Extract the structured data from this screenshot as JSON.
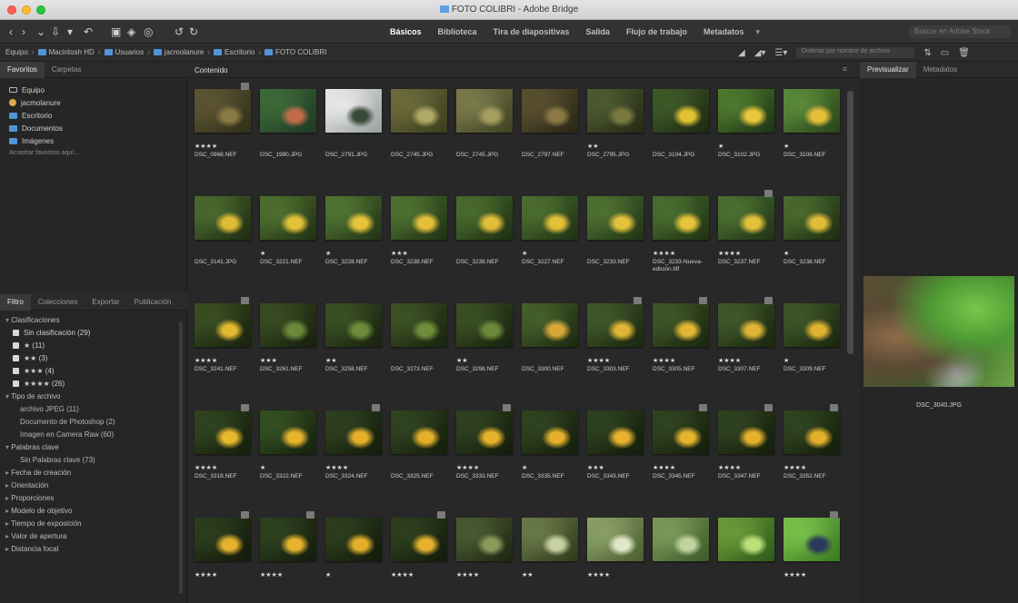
{
  "window": {
    "title": "FOTO COLIBRI - Adobe Bridge"
  },
  "workspaces": {
    "tabs": [
      "Básicos",
      "Biblioteca",
      "Tira de diapositivas",
      "Salida",
      "Flujo de trabajo",
      "Metadatos"
    ],
    "active": 0,
    "more": "▾"
  },
  "search": {
    "placeholder": "Buscar en Adobe Stock"
  },
  "path": {
    "crumbs": [
      "Equipo",
      "Macintosh HD",
      "Usuarios",
      "jacmolanure",
      "Escritorio",
      "FOTO COLIBRI"
    ]
  },
  "filter_search": {
    "placeholder": "Ordenar por nombre de archivo"
  },
  "left_top": {
    "tabs": [
      "Favoritos",
      "Carpetas"
    ],
    "items": [
      {
        "label": "Equipo",
        "icon": "computer-icon"
      },
      {
        "label": "jacmolanure",
        "icon": "user-icon"
      },
      {
        "label": "Escritorio",
        "icon": "folder-icon"
      },
      {
        "label": "Documentos",
        "icon": "folder-icon"
      },
      {
        "label": "Imágenes",
        "icon": "folder-icon"
      }
    ],
    "drag_hint": "Arrastrar favoritos aquí..."
  },
  "left_bottom": {
    "tabs": [
      "Filtro",
      "Colecciones",
      "Exportar",
      "Publicación"
    ],
    "rows": [
      {
        "type": "sec",
        "label": "Clasificaciones"
      },
      {
        "type": "item",
        "label": "Sin clasificación (29)",
        "check": true
      },
      {
        "type": "item",
        "label": "★ (11)",
        "check": true
      },
      {
        "type": "item",
        "label": "★★ (3)",
        "check": true
      },
      {
        "type": "item",
        "label": "★★★ (4)",
        "check": true
      },
      {
        "type": "item",
        "label": "★★★★ (26)",
        "check": true
      },
      {
        "type": "sec",
        "label": "Tipo de archivo"
      },
      {
        "type": "sub",
        "label": "archivo JPEG (11)"
      },
      {
        "type": "sub",
        "label": "Documento de Photoshop (2)"
      },
      {
        "type": "sub",
        "label": "Imagen en Camera Raw (60)"
      },
      {
        "type": "sec",
        "label": "Palabras clave"
      },
      {
        "type": "sub",
        "label": "Sin Palabras clave (73)"
      },
      {
        "type": "sec closed",
        "label": "Fecha de creación"
      },
      {
        "type": "sec closed",
        "label": "Orientación"
      },
      {
        "type": "sec closed",
        "label": "Proporciones"
      },
      {
        "type": "sec closed",
        "label": "Modelo de objetivo"
      },
      {
        "type": "sec closed",
        "label": "Tiempo de exposición"
      },
      {
        "type": "sec closed",
        "label": "Valor de apertura"
      },
      {
        "type": "sec closed",
        "label": "Distancia focal"
      }
    ]
  },
  "content": {
    "title": "Contenido",
    "menu": "≡"
  },
  "thumbnails": [
    {
      "stars": "★★★★",
      "name": "DSC_0968.NEF",
      "badge": true,
      "c1": "#5c5433",
      "c2": "#2f3018",
      "c3": "#8a7a44"
    },
    {
      "stars": "",
      "name": "DSC_1980.JPG",
      "badge": false,
      "c1": "#3d6a38",
      "c2": "#1f3a25",
      "c3": "#c26b4a"
    },
    {
      "stars": "",
      "name": "DSC_2791.JPG",
      "badge": false,
      "c1": "#e8e8e8",
      "c2": "#9aa0a0",
      "c3": "#3a4a3a"
    },
    {
      "stars": "",
      "name": "DSC_2745.JPG",
      "badge": false,
      "c1": "#6b6a3a",
      "c2": "#3c3e1f",
      "c3": "#b0a866"
    },
    {
      "stars": "",
      "name": "DSC_2745.JPG",
      "badge": false,
      "c1": "#7a7a4c",
      "c2": "#3f4221",
      "c3": "#a79d5f"
    },
    {
      "stars": "",
      "name": "DSC_2797.NEF",
      "badge": false,
      "c1": "#5a5030",
      "c2": "#2a2616",
      "c3": "#8c7a45"
    },
    {
      "stars": "★★",
      "name": "DSC_2795.JPG",
      "badge": false,
      "c1": "#4e5a30",
      "c2": "#252a16",
      "c3": "#7a7a40"
    },
    {
      "stars": "",
      "name": "DSC_3104.JPG",
      "badge": false,
      "c1": "#3e5a28",
      "c2": "#1e2a12",
      "c3": "#e2c234"
    },
    {
      "stars": "★",
      "name": "DSC_3102.JPG",
      "badge": false,
      "c1": "#4f7a30",
      "c2": "#1e3414",
      "c3": "#e8c73a"
    },
    {
      "stars": "★",
      "name": "DSC_3108.NEF",
      "badge": false,
      "c1": "#5a8a3a",
      "c2": "#2a4418",
      "c3": "#e6c03a"
    },
    {
      "stars": "",
      "name": "DSC_3141.JPG",
      "badge": false,
      "c1": "#4a6a2e",
      "c2": "#1f2c12",
      "c3": "#e0bc36"
    },
    {
      "stars": "★",
      "name": "DSC_3221.NEF",
      "badge": false,
      "c1": "#4f7030",
      "c2": "#223214",
      "c3": "#e3c23a"
    },
    {
      "stars": "★",
      "name": "DSC_3228.NEF",
      "badge": false,
      "c1": "#507432",
      "c2": "#223416",
      "c3": "#e5c43b"
    },
    {
      "stars": "★★★",
      "name": "DSC_3238.NEF",
      "badge": false,
      "c1": "#4e7230",
      "c2": "#203214",
      "c3": "#e4c03a"
    },
    {
      "stars": "",
      "name": "DSC_3238.NEF",
      "badge": false,
      "c1": "#4a6c2e",
      "c2": "#1e3012",
      "c3": "#e2be38"
    },
    {
      "stars": "★",
      "name": "DSC_3227.NEF",
      "badge": false,
      "c1": "#4c6e30",
      "c2": "#203214",
      "c3": "#e3c03a"
    },
    {
      "stars": "",
      "name": "DSC_3233.NEF",
      "badge": false,
      "c1": "#4e7232",
      "c2": "#223416",
      "c3": "#e4c23c"
    },
    {
      "stars": "★★★★",
      "name": "DSC_3233-Nueva-edición.tiff",
      "badge": false,
      "wrap": true,
      "c1": "#4a6e30",
      "c2": "#1f3214",
      "c3": "#e6c43c"
    },
    {
      "stars": "★★★★",
      "name": "DSC_3237.NEF",
      "badge": true,
      "c1": "#4c7032",
      "c2": "#203416",
      "c3": "#e3c13a"
    },
    {
      "stars": "★",
      "name": "DSC_3238.NEF",
      "badge": false,
      "c1": "#4a6a2e",
      "c2": "#1e2e12",
      "c3": "#e0bc38"
    },
    {
      "stars": "★★★★",
      "name": "DSC_3241.NEF",
      "badge": true,
      "c1": "#3a4e22",
      "c2": "#18220e",
      "c3": "#e0b832"
    },
    {
      "stars": "★★★",
      "name": "DSC_3261.NEF",
      "badge": false,
      "c1": "#384c22",
      "c2": "#17200e",
      "c3": "#6a8a3a"
    },
    {
      "stars": "★★",
      "name": "DSC_3258.NEF",
      "badge": false,
      "c1": "#3a5024",
      "c2": "#18220e",
      "c3": "#6c8c3c"
    },
    {
      "stars": "",
      "name": "DSC_3273.NEF",
      "badge": false,
      "c1": "#3c5224",
      "c2": "#19230f",
      "c3": "#6e8e3e"
    },
    {
      "stars": "★★",
      "name": "DSC_3298.NEF",
      "badge": false,
      "c1": "#3a5024",
      "c2": "#18220e",
      "c3": "#6a8a3a"
    },
    {
      "stars": "",
      "name": "DSC_3300.NEF",
      "badge": false,
      "c1": "#44602a",
      "c2": "#1c2a10",
      "c3": "#d8a83a"
    },
    {
      "stars": "★★★★",
      "name": "DSC_3303.NEF",
      "badge": true,
      "c1": "#40582a",
      "c2": "#1a2610",
      "c3": "#e0b434"
    },
    {
      "stars": "★★★★",
      "name": "DSC_3305.NEF",
      "badge": true,
      "c1": "#3e5628",
      "c2": "#1a2610",
      "c3": "#e2b634"
    },
    {
      "stars": "★★★★",
      "name": "DSC_3307.NEF",
      "badge": true,
      "c1": "#40582a",
      "c2": "#1a2610",
      "c3": "#e0b434"
    },
    {
      "stars": "★",
      "name": "DSC_3309.NEF",
      "badge": false,
      "c1": "#3e5628",
      "c2": "#1a260f",
      "c3": "#deb234"
    },
    {
      "stars": "★★★★",
      "name": "DSC_3318.NEF",
      "badge": true,
      "c1": "#304420",
      "c2": "#141e0c",
      "c3": "#e8b82e"
    },
    {
      "stars": "★",
      "name": "DSC_3322.NEF",
      "badge": false,
      "c1": "#345022",
      "c2": "#16220d",
      "c3": "#e6b42e"
    },
    {
      "stars": "★★★★",
      "name": "DSC_3324.NEF",
      "badge": true,
      "c1": "#2e4020",
      "c2": "#131c0b",
      "c3": "#e6b02c"
    },
    {
      "stars": "",
      "name": "DSC_3325.NEF",
      "badge": false,
      "c1": "#304420",
      "c2": "#141e0c",
      "c3": "#e4b02c"
    },
    {
      "stars": "★★★★",
      "name": "DSC_3333.NEF",
      "badge": true,
      "c1": "#2f4220",
      "c2": "#141d0b",
      "c3": "#e6b22e"
    },
    {
      "stars": "★",
      "name": "DSC_3335.NEF",
      "badge": false,
      "c1": "#304420",
      "c2": "#141e0c",
      "c3": "#e5b02c"
    },
    {
      "stars": "★★★",
      "name": "DSC_3343.NEF",
      "badge": false,
      "c1": "#2e4220",
      "c2": "#131c0b",
      "c3": "#e6b22e"
    },
    {
      "stars": "★★★★",
      "name": "DSC_3345.NEF",
      "badge": true,
      "c1": "#304420",
      "c2": "#141e0c",
      "c3": "#e7b42e"
    },
    {
      "stars": "★★★★",
      "name": "DSC_3347.NEF",
      "badge": true,
      "c1": "#2f4320",
      "c2": "#141d0b",
      "c3": "#e6b22e"
    },
    {
      "stars": "★★★★",
      "name": "DSC_3352.NEF",
      "badge": true,
      "c1": "#304420",
      "c2": "#141e0c",
      "c3": "#e4b02c"
    },
    {
      "stars": "★★★★",
      "name": "",
      "badge": true,
      "c1": "#2c3e1e",
      "c2": "#121a0a",
      "c3": "#e6b22e"
    },
    {
      "stars": "★★★★",
      "name": "",
      "badge": true,
      "c1": "#2e4220",
      "c2": "#131c0b",
      "c3": "#e8b42e"
    },
    {
      "stars": "★",
      "name": "",
      "badge": false,
      "c1": "#2c3e1e",
      "c2": "#121a0a",
      "c3": "#e4b02c"
    },
    {
      "stars": "★★★★",
      "name": "",
      "badge": true,
      "c1": "#2e401f",
      "c2": "#131c0b",
      "c3": "#e6b22e"
    },
    {
      "stars": "★★★★",
      "name": "",
      "badge": false,
      "c1": "#4a5a32",
      "c2": "#1e2612",
      "c3": "#8a9a5a"
    },
    {
      "stars": "★★",
      "name": "",
      "badge": false,
      "c1": "#6a7a48",
      "c2": "#2e3a1c",
      "c3": "#c8d0a0"
    },
    {
      "stars": "★★★★",
      "name": "",
      "badge": false,
      "c1": "#8aa068",
      "c2": "#4a5e30",
      "c3": "#dfe8c8"
    },
    {
      "stars": "",
      "name": "",
      "badge": false,
      "c1": "#7a9a5a",
      "c2": "#3e5a2a",
      "c3": "#c0d4a0"
    },
    {
      "stars": "",
      "name": "",
      "badge": false,
      "c1": "#6a9a3a",
      "c2": "#2e5a18",
      "c3": "#b8e07a"
    },
    {
      "stars": "★★★★",
      "name": "",
      "badge": true,
      "c1": "#7ac04a",
      "c2": "#3a7a22",
      "c3": "#2a3a5a"
    }
  ],
  "right": {
    "tabs": [
      "Previsualizar",
      "Metadatos"
    ],
    "preview_name": "DSC_3040.JPG"
  }
}
